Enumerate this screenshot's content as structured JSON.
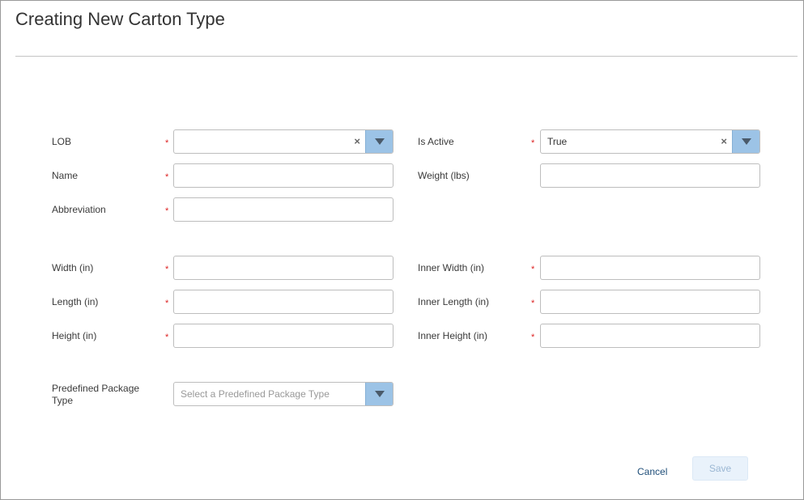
{
  "dialog": {
    "title": "Creating New Carton Type"
  },
  "required_marker": "*",
  "form": {
    "lob": {
      "label": "LOB",
      "value": "",
      "clear": "×"
    },
    "is_active": {
      "label": "Is Active",
      "value": "True",
      "clear": "×"
    },
    "name": {
      "label": "Name",
      "value": ""
    },
    "weight": {
      "label": "Weight (lbs)",
      "value": ""
    },
    "abbreviation": {
      "label": "Abbreviation",
      "value": ""
    },
    "width": {
      "label": "Width (in)",
      "value": ""
    },
    "inner_width": {
      "label": "Inner Width (in)",
      "value": ""
    },
    "length": {
      "label": "Length (in)",
      "value": ""
    },
    "inner_length": {
      "label": "Inner Length (in)",
      "value": ""
    },
    "height": {
      "label": "Height (in)",
      "value": ""
    },
    "inner_height": {
      "label": "Inner Height (in)",
      "value": ""
    },
    "predefined_package": {
      "label_line1": "Predefined Package",
      "label_line2": "Type",
      "placeholder": "Select a Predefined Package Type"
    }
  },
  "actions": {
    "cancel_label": "Cancel",
    "save_label": "Save"
  },
  "colors": {
    "dropdown_button": "#9cc3e6",
    "required": "#dd2222",
    "link": "#1f4e79",
    "save_disabled_bg": "#e9f2fb"
  },
  "icons": {
    "dropdown": "chevron-down-icon",
    "clear": "clear-icon"
  }
}
